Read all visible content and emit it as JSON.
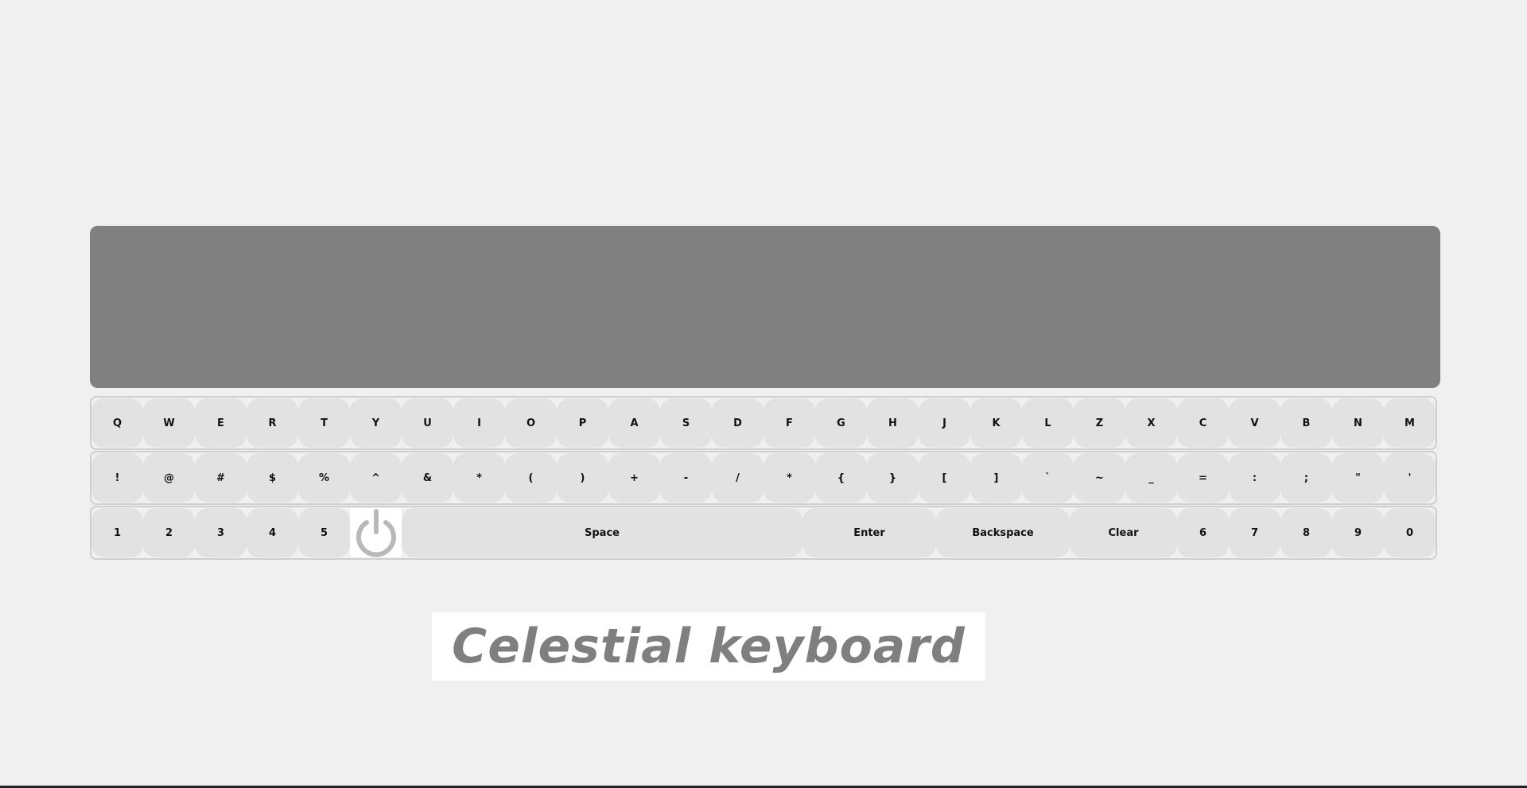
{
  "display": {
    "text": ""
  },
  "keyboard": {
    "row1": [
      "Q",
      "W",
      "E",
      "R",
      "T",
      "Y",
      "U",
      "I",
      "O",
      "P",
      "A",
      "S",
      "D",
      "F",
      "G",
      "H",
      "J",
      "K",
      "L",
      "Z",
      "X",
      "C",
      "V",
      "B",
      "N",
      "M"
    ],
    "row2": [
      "!",
      "@",
      "#",
      "$",
      "%",
      "^",
      "&",
      "*",
      "(",
      ")",
      "+",
      "-",
      "/",
      "*",
      "{",
      "}",
      "[",
      "]",
      "`",
      "~",
      "_",
      "=",
      ":",
      ";",
      "\"",
      "'"
    ],
    "row3_left": [
      "1",
      "2",
      "3",
      "4",
      "5"
    ],
    "power_icon": "power-icon",
    "space_label": "Space",
    "enter_label": "Enter",
    "backspace_label": "Backspace",
    "clear_label": "Clear",
    "row3_right": [
      "6",
      "7",
      "8",
      "9",
      "0"
    ]
  },
  "logo": {
    "text": "Celestial keyboard"
  },
  "colors": {
    "background": "#f0f0f0",
    "display": "#808080",
    "key": "#e2e2e2",
    "logo_text": "#7f7f7f"
  }
}
